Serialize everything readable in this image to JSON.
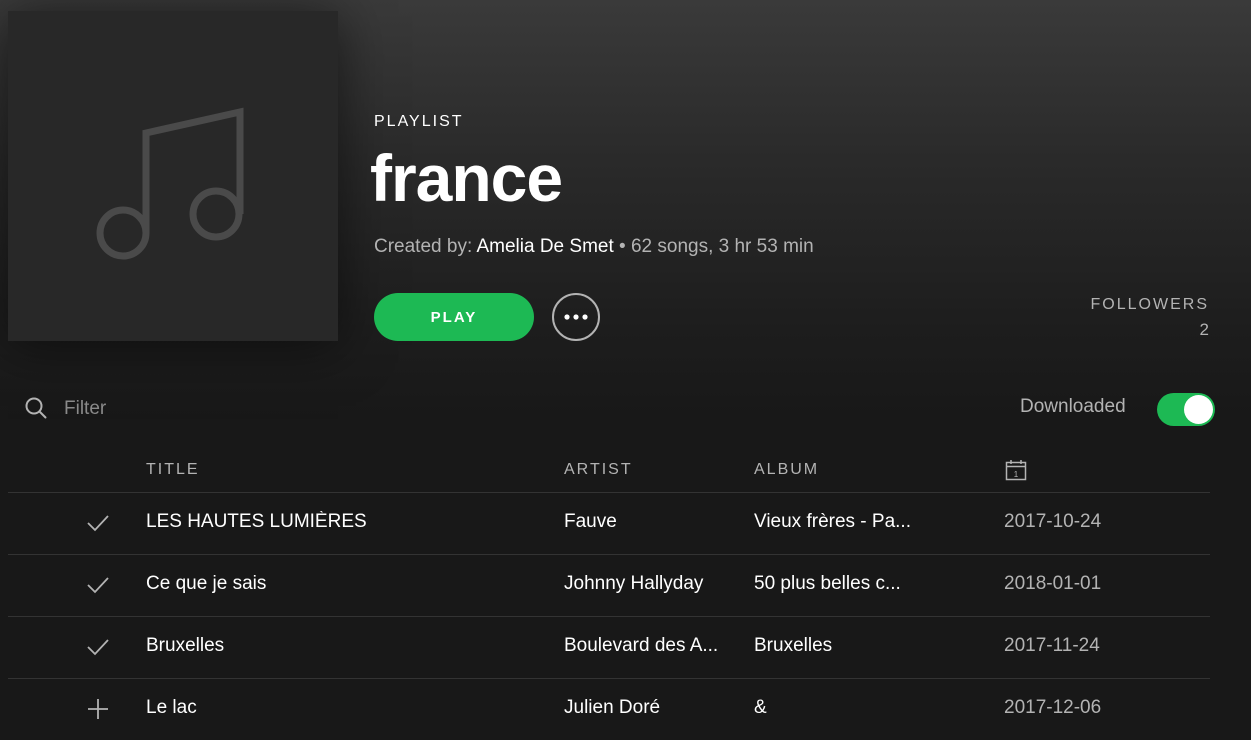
{
  "playlist": {
    "type_label": "PLAYLIST",
    "title": "france",
    "created_by_label": "Created by:",
    "owner": "Amelia De Smet",
    "separator": "•",
    "summary": "62 songs, 3 hr 53 min",
    "play_label": "PLAY",
    "more_icon": "more-horizontal-icon",
    "cover_icon": "music-note-icon"
  },
  "followers": {
    "label": "FOLLOWERS",
    "count": "2"
  },
  "filter": {
    "placeholder": "Filter",
    "icon": "search-icon"
  },
  "downloaded": {
    "label": "Downloaded",
    "enabled": true
  },
  "columns": {
    "title": "TITLE",
    "artist": "ARTIST",
    "album": "ALBUM",
    "date_icon": "calendar-icon"
  },
  "tracks": [
    {
      "status": "check",
      "title": "LES HAUTES LUMIÈRES",
      "artist": "Fauve",
      "album": "Vieux frères - Pa...",
      "date": "2017-10-24"
    },
    {
      "status": "check",
      "title": "Ce que je sais",
      "artist": "Johnny Hallyday",
      "album": "50 plus belles c...",
      "date": "2018-01-01"
    },
    {
      "status": "check",
      "title": "Bruxelles",
      "artist": "Boulevard des A...",
      "album": "Bruxelles",
      "date": "2017-11-24"
    },
    {
      "status": "add",
      "title": "Le lac",
      "artist": "Julien Doré",
      "album": "&",
      "date": "2017-12-06"
    }
  ],
  "colors": {
    "accent": "#1db954",
    "background": "#181818",
    "muted_text": "#b3b3b3"
  }
}
